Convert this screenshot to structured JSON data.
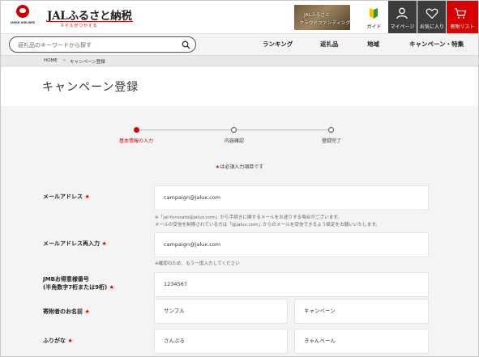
{
  "header": {
    "logo_caption": "JAPAN AIRLINES",
    "brand_title": "JALふるさと納税",
    "brand_sub": "マイルがつかえる",
    "crowdfunding_line1": "JALふるさと",
    "crowdfunding_line2": "クラウドファンディング",
    "guide_label": "ガイド",
    "mypage_label": "マイページ",
    "favorites_label": "お気に入り",
    "cart_label": "寄附リスト"
  },
  "nav": {
    "search_placeholder": "返礼品のキーワードから探す",
    "items": [
      "ランキング",
      "返礼品",
      "地域",
      "キャンペーン・特集"
    ]
  },
  "breadcrumb": {
    "home": "HOME",
    "separator": ">",
    "current": "キャンペーン登録"
  },
  "page_title": "キャンペーン登録",
  "steps": [
    {
      "label": "基本情報の入力",
      "active": true
    },
    {
      "label": "内容確認",
      "active": false
    },
    {
      "label": "登録完了",
      "active": false
    }
  ],
  "required_note": {
    "star": "★",
    "text": "は必須入力項目です"
  },
  "form": {
    "required_mark": "★",
    "email_label": "メールアドレス",
    "email_value": "campaign@jalux.com",
    "email_note_line1": "※「jal-furusato@jalux.com」から手続きに関するメールをお送りする場合がございます。",
    "email_note_line2": "メールの受信を制限されている方は「@jalux.com」からのメールを受信できるよう設定をお願いいたします。",
    "email_confirm_label": "メールアドレス再入力",
    "email_confirm_value": "campaign@jalux.com",
    "email_confirm_note": "※確認のため、もう一度入力してください",
    "jmb_label_line1": "JMBお得意様番号",
    "jmb_label_line2": "(半角数字7桁または9桁)",
    "jmb_value": "1234567",
    "name_label": "寄附者のお名前",
    "last_name_value": "サンプル",
    "first_name_value": "キャンペーン",
    "kana_label": "ふりがな",
    "last_kana_value": "さんぷる",
    "first_kana_value": "きゃんぺーん"
  },
  "colors": {
    "accent_red": "#d90000",
    "header_dark": "#3c3c3c",
    "background": "#f4f4f4"
  }
}
